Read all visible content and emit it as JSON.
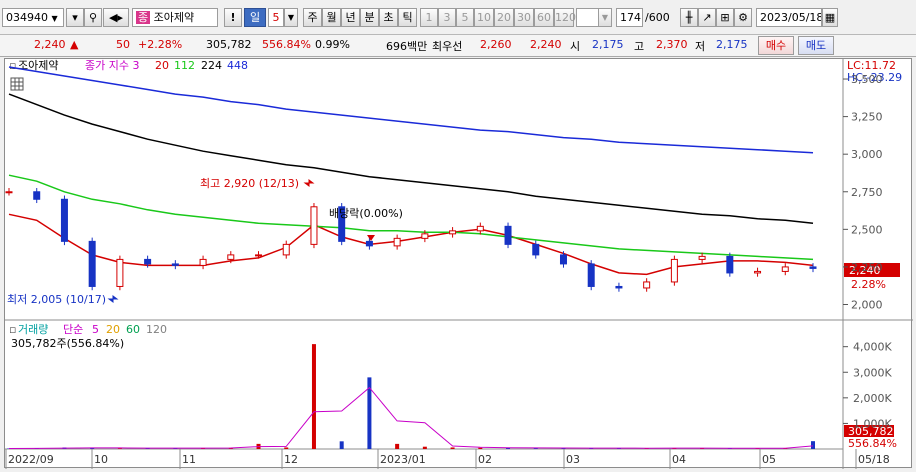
{
  "toolbar": {
    "stock_code": "034940",
    "stock_name": "조아제약",
    "period_buttons": [
      "일",
      "5",
      "주",
      "월",
      "년",
      "분",
      "초",
      "틱"
    ],
    "active_period": "일",
    "num_buttons": [
      "1",
      "3",
      "5",
      "10",
      "20",
      "30",
      "60",
      "120"
    ],
    "count": "174",
    "count_total": "/600",
    "date": "2023/05/18",
    "search_icon": "magnifier-icon",
    "sound_icon": "speaker-icon",
    "settings_icon": "gear-icon",
    "print_icon": "printer-icon",
    "layout_icon": "grid-icon"
  },
  "quote": {
    "price": "2,240",
    "arrow": "▲",
    "change": "50",
    "change_pct": "+2.28%",
    "volume": "305,782",
    "vol_ratio": "556.84%",
    "turnover": "0.99%",
    "amount": "696백만",
    "best_label": "최우선",
    "best_ask": "2,260",
    "best_bid": "2,240",
    "open_label": "시",
    "open": "2,175",
    "high_label": "고",
    "high": "2,370",
    "low_label": "저",
    "low": "2,175",
    "buy_label": "매수",
    "sell_label": "매도"
  },
  "price_chart": {
    "legend_name": "조아제약",
    "legend_title": "종가 지수 3",
    "ma_labels": [
      "20",
      "112",
      "224",
      "448"
    ],
    "ma_colors": [
      "#d40000",
      "#19c819",
      "#000000",
      "#1a2ad8"
    ],
    "lc": "LC:11.72",
    "hc": "HC:-23.29",
    "high_ann": "최고 2,920 (12/13)",
    "low_ann": "최저 2,005 (10/17)",
    "div_ann": "배당락(0.00%)",
    "cur_price_tag": "2,240",
    "cur_pct_tag": "2.28%"
  },
  "volume_chart": {
    "legend_title": "거래량",
    "ma_title": "단순",
    "ma_labels": [
      "5",
      "20",
      "60",
      "120"
    ],
    "ma_colors": [
      "#c800c8",
      "#e0a000",
      "#00a050",
      "#808080"
    ],
    "current": "305,782주(556.84%)",
    "tag_vol": "305,782",
    "tag_pct": "556.84%"
  },
  "chart_data": {
    "type": "line",
    "y_ticks": [
      "3,500",
      "3,250",
      "3,000",
      "2,750",
      "2,500",
      "2,250",
      "2,000"
    ],
    "vol_ticks": [
      "4,000K",
      "3,000K",
      "2,000K",
      "1,000K"
    ],
    "x_labels": [
      "2022/09",
      "10",
      "11",
      "12",
      "2023/01",
      "02",
      "03",
      "04",
      "05",
      "05/18"
    ],
    "ylim": [
      1990,
      3580
    ],
    "series": [
      {
        "name": "20",
        "color": "#d40000",
        "values": [
          2600,
          2560,
          2440,
          2330,
          2280,
          2260,
          2260,
          2260,
          2290,
          2310,
          2380,
          2530,
          2450,
          2400,
          2420,
          2450,
          2480,
          2500,
          2460,
          2400,
          2340,
          2270,
          2210,
          2200,
          2250,
          2270,
          2290,
          2290,
          2280,
          2260
        ]
      },
      {
        "name": "112",
        "color": "#19c819",
        "values": [
          2860,
          2820,
          2750,
          2700,
          2670,
          2630,
          2600,
          2580,
          2560,
          2540,
          2530,
          2520,
          2510,
          2490,
          2490,
          2480,
          2480,
          2470,
          2450,
          2430,
          2410,
          2390,
          2370,
          2360,
          2350,
          2340,
          2330,
          2320,
          2310,
          2300
        ]
      },
      {
        "name": "224",
        "color": "#000000",
        "values": [
          3400,
          3330,
          3260,
          3200,
          3150,
          3100,
          3060,
          3020,
          2990,
          2960,
          2930,
          2910,
          2880,
          2850,
          2830,
          2810,
          2790,
          2770,
          2750,
          2720,
          2700,
          2680,
          2660,
          2640,
          2620,
          2600,
          2590,
          2570,
          2560,
          2540
        ]
      },
      {
        "name": "448",
        "color": "#1a2ad8",
        "values": [
          3580,
          3550,
          3520,
          3490,
          3460,
          3430,
          3400,
          3380,
          3350,
          3330,
          3300,
          3280,
          3260,
          3240,
          3220,
          3200,
          3180,
          3160,
          3150,
          3130,
          3110,
          3100,
          3080,
          3070,
          3060,
          3050,
          3040,
          3030,
          3020,
          3010
        ]
      },
      {
        "name": "close",
        "color": "#1733c4",
        "values": [
          2750,
          2700,
          2420,
          2120,
          2300,
          2270,
          2260,
          2300,
          2330,
          2330,
          2400,
          2650,
          2420,
          2390,
          2440,
          2470,
          2490,
          2520,
          2400,
          2330,
          2270,
          2120,
          2110,
          2150,
          2300,
          2320,
          2210,
          2220,
          2250,
          2240
        ]
      }
    ],
    "volume_k": [
      20,
      30,
      60,
      40,
      30,
      40,
      30,
      40,
      45,
      200,
      60,
      4100,
      300,
      2800,
      200,
      90,
      60,
      50,
      40,
      35,
      40,
      30,
      35,
      30,
      40,
      30,
      25,
      30,
      30,
      306
    ]
  }
}
